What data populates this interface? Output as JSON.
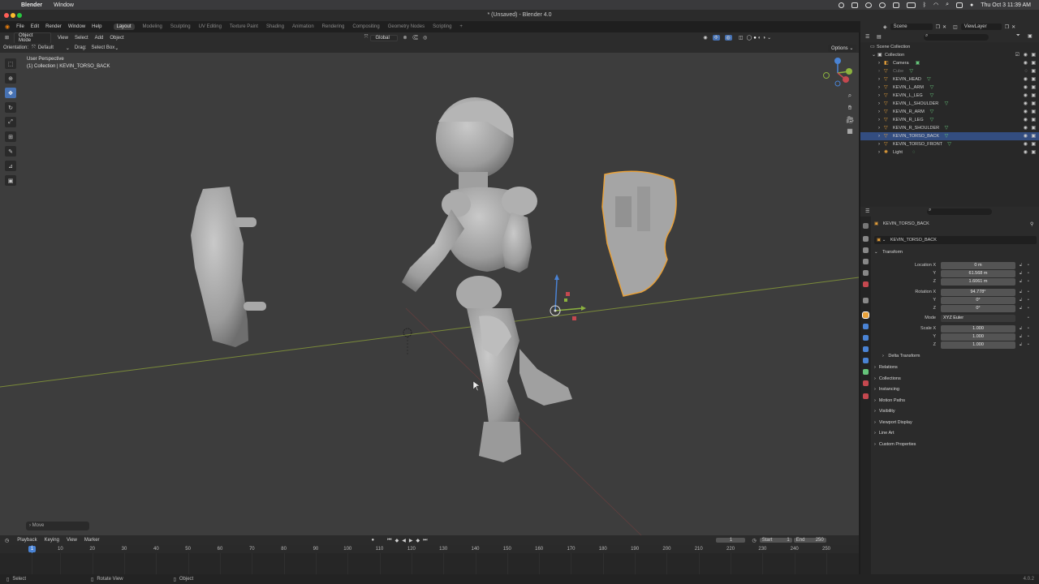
{
  "macos": {
    "apple": "",
    "app_name": "Blender",
    "menu": [
      "Window"
    ],
    "clock": "Thu Oct 3  11:39 AM"
  },
  "window": {
    "title": "* (Unsaved) - Blender 4.0"
  },
  "topmenu": {
    "items": [
      "File",
      "Edit",
      "Render",
      "Window",
      "Help"
    ],
    "workspaces": [
      "Layout",
      "Modeling",
      "Sculpting",
      "UV Editing",
      "Texture Paint",
      "Shading",
      "Animation",
      "Rendering",
      "Compositing",
      "Geometry Nodes",
      "Scripting"
    ],
    "active_workspace": "Layout",
    "scene": "Scene",
    "view_layer": "ViewLayer"
  },
  "viewport_header": {
    "mode": "Object Mode",
    "menus": [
      "View",
      "Select",
      "Add",
      "Object"
    ],
    "transform_orientation": "Global",
    "orientation_label": "Orientation:",
    "orientation_value": "Default",
    "drag_label": "Drag:",
    "drag_value": "Select Box",
    "options": "Options"
  },
  "viewport": {
    "view_name": "User Perspective",
    "collection_info": "(1) Collection | KEVIN_TORSO_BACK",
    "last_operator": "Move"
  },
  "timeline": {
    "menus": [
      "Playback",
      "Keying",
      "View",
      "Marker"
    ],
    "current_frame": "1",
    "start_label": "Start",
    "start": "1",
    "end_label": "End",
    "end": "250",
    "ticks": [
      "1",
      "10",
      "20",
      "30",
      "40",
      "50",
      "60",
      "70",
      "80",
      "90",
      "100",
      "110",
      "120",
      "130",
      "140",
      "150",
      "160",
      "170",
      "180",
      "190",
      "200",
      "210",
      "220",
      "230",
      "240",
      "250"
    ]
  },
  "statusbar": {
    "items": [
      "Select",
      "Rotate View",
      "Object"
    ],
    "version": "4.0.2"
  },
  "outliner": {
    "root": "Scene Collection",
    "collection": "Collection",
    "objects": [
      {
        "name": "Camera",
        "type": "camera",
        "selected": false,
        "disabled": false
      },
      {
        "name": "Cube",
        "type": "mesh",
        "selected": false,
        "disabled": true
      },
      {
        "name": "KEVIN_HEAD",
        "type": "mesh",
        "selected": false,
        "disabled": false
      },
      {
        "name": "KEVIN_L_ARM",
        "type": "mesh",
        "selected": false,
        "disabled": false
      },
      {
        "name": "KEVIN_L_LEG",
        "type": "mesh",
        "selected": false,
        "disabled": false
      },
      {
        "name": "KEVIN_L_SHOULDER",
        "type": "mesh",
        "selected": false,
        "disabled": false
      },
      {
        "name": "KEVIN_R_ARM",
        "type": "mesh",
        "selected": false,
        "disabled": false
      },
      {
        "name": "KEVIN_R_LEG",
        "type": "mesh",
        "selected": false,
        "disabled": false
      },
      {
        "name": "KEVIN_R_SHOULDER",
        "type": "mesh",
        "selected": false,
        "disabled": false
      },
      {
        "name": "KEVIN_TORSO_BACK",
        "type": "mesh",
        "selected": true,
        "disabled": false
      },
      {
        "name": "KEVIN_TORSO_FRONT",
        "type": "mesh",
        "selected": false,
        "disabled": false
      },
      {
        "name": "Light",
        "type": "light",
        "selected": false,
        "disabled": false
      }
    ]
  },
  "properties": {
    "object_name_top": "KEVIN_TORSO_BACK",
    "object_name": "KEVIN_TORSO_BACK",
    "transform_title": "Transform",
    "location_label": "Location X",
    "location": [
      "0 m",
      "61.568 m",
      "1.6061 m"
    ],
    "rotation_label": "Rotation X",
    "rotation": [
      "94.778°",
      "0°",
      "0°"
    ],
    "mode_label": "Mode",
    "mode_value": "XYZ Euler",
    "scale_label": "Scale X",
    "scale": [
      "1.000",
      "1.000",
      "1.000"
    ],
    "axis_y": "Y",
    "axis_z": "Z",
    "delta_transform": "Delta Transform",
    "panels": [
      "Relations",
      "Collections",
      "Instancing",
      "Motion Paths",
      "Visibility",
      "Viewport Display",
      "Line Art",
      "Custom Properties"
    ]
  },
  "colors": {
    "selection_outline": "#e8a13a",
    "active_tool": "#4772b3",
    "outliner_selected": "#334d80",
    "x_axis": "#c5484f",
    "y_axis": "#8cb23f",
    "z_axis": "#4a83d4"
  }
}
